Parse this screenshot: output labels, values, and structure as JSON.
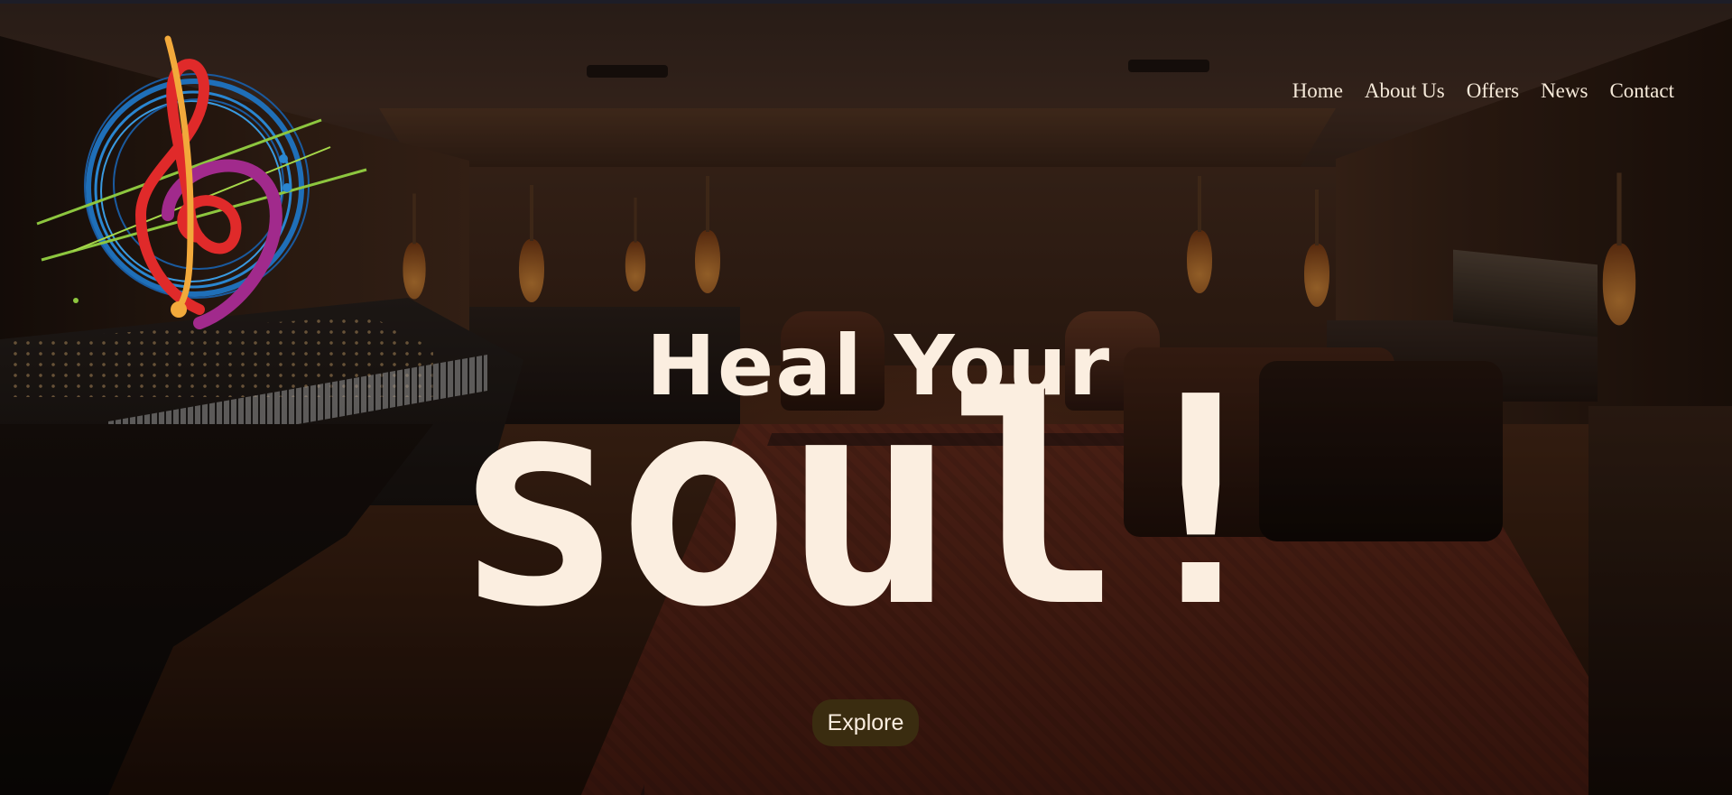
{
  "site": {
    "logo_icon": "treble-bass-clef-logo-icon"
  },
  "nav": {
    "items": [
      {
        "label": "Home"
      },
      {
        "label": "About Us"
      },
      {
        "label": "Offers"
      },
      {
        "label": "News"
      },
      {
        "label": "Contact"
      }
    ]
  },
  "hero": {
    "headline_line1": "Heal Your",
    "headline_line2": "soul!",
    "cta_label": "Explore",
    "text_color": "#fbeee0",
    "cta_color": "#3a2c10"
  }
}
